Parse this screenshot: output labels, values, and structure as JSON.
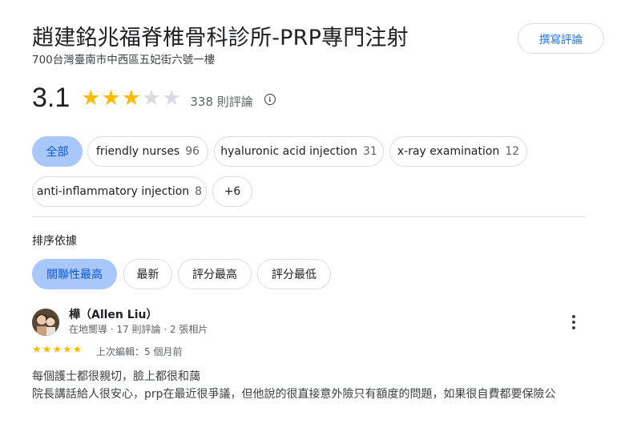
{
  "place": {
    "title": "趙建銘兆福脊椎骨科診所-PRP專門注射",
    "address": "700台灣臺南市中西區五妃街六號一樓",
    "write_review_label": "撰寫評論"
  },
  "rating": {
    "value": "3.1",
    "stars_filled": 3,
    "stars_total": 5,
    "count_label": "338 則評論",
    "info_icon": "info-circle-icon"
  },
  "topics": [
    {
      "label": "全部",
      "count": "",
      "active": true
    },
    {
      "label": "friendly nurses",
      "count": "96",
      "active": false
    },
    {
      "label": "hyaluronic acid injection",
      "count": "31",
      "active": false
    },
    {
      "label": "x-ray examination",
      "count": "12",
      "active": false
    },
    {
      "label": "anti-inflammatory injection",
      "count": "8",
      "active": false
    },
    {
      "label": "+6",
      "count": "",
      "active": false
    }
  ],
  "sort": {
    "label": "排序依據",
    "options": [
      {
        "label": "關聯性最高",
        "active": true
      },
      {
        "label": "最新",
        "active": false
      },
      {
        "label": "評分最高",
        "active": false
      },
      {
        "label": "評分最低",
        "active": false
      }
    ]
  },
  "review": {
    "name": "樺（Allen Liu）",
    "meta": "在地嚮導 · 17 則評論 · 2 張相片",
    "rating": 5,
    "edited": "上次編輯：5 個月前",
    "text_line1": "每個護士都很親切，臉上都很和藹",
    "text_line2": "院長講話給人很安心，prp在最近很爭議，但他說的很直接意外險只有額度的問題，如果很自費都要保險公"
  },
  "colors": {
    "star": "#fbbc04",
    "star_empty": "#dadce0",
    "active_chip": "#a8c7fa",
    "accent": "#1a73e8"
  }
}
